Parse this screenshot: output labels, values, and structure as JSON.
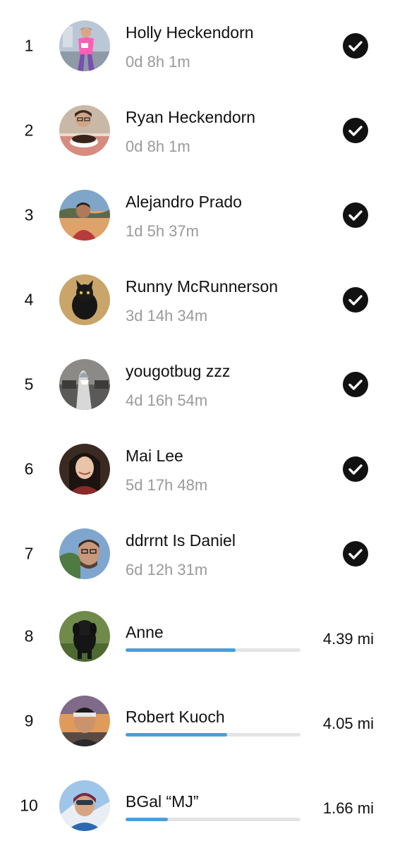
{
  "leaderboard": {
    "completed": [
      {
        "rank": "1",
        "name": "Holly Heckendorn",
        "time": "0d 8h 1m",
        "avatar": "avatar-runner-pink"
      },
      {
        "rank": "2",
        "name": "Ryan Heckendorn",
        "time": "0d 8h 1m",
        "avatar": "avatar-man-pie"
      },
      {
        "rank": "3",
        "name": "Alejandro Prado",
        "time": "1d 5h 37m",
        "avatar": "avatar-man-sunset"
      },
      {
        "rank": "4",
        "name": "Runny McRunnerson",
        "time": "3d 14h 34m",
        "avatar": "avatar-black-cat"
      },
      {
        "rank": "5",
        "name": "yougotbug zzz",
        "time": "4d 16h 54m",
        "avatar": "avatar-shark-costume"
      },
      {
        "rank": "6",
        "name": "Mai Lee",
        "time": "5d 17h 48m",
        "avatar": "avatar-woman-smiling"
      },
      {
        "rank": "7",
        "name": "ddrrnt Is Daniel",
        "time": "6d 12h 31m",
        "avatar": "avatar-man-glasses"
      }
    ],
    "in_progress": [
      {
        "rank": "8",
        "name": "Anne",
        "distance": "4.39 mi",
        "progress": 0.63,
        "avatar": "avatar-black-dog"
      },
      {
        "rank": "9",
        "name": "Robert Kuoch",
        "distance": "4.05 mi",
        "progress": 0.58,
        "avatar": "avatar-man-headband"
      },
      {
        "rank": "10",
        "name": "BGal “MJ”",
        "distance": "1.66 mi",
        "progress": 0.24,
        "avatar": "avatar-woman-snow"
      }
    ],
    "colors": {
      "progress_fill": "#4a9fd6",
      "progress_track": "#e4e4e4",
      "secondary_text": "#9a9a9a",
      "check_circle": "#111111"
    }
  }
}
